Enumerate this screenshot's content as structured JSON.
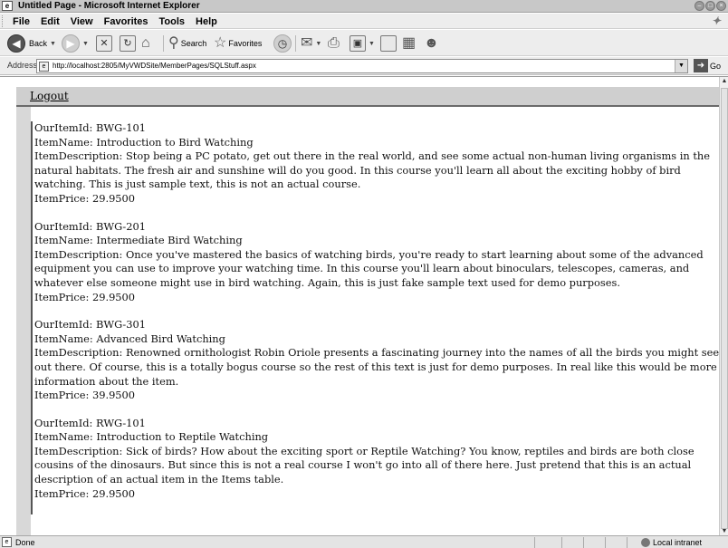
{
  "window": {
    "title": "Untitled Page - Microsoft Internet Explorer"
  },
  "menu": [
    "File",
    "Edit",
    "View",
    "Favorites",
    "Tools",
    "Help"
  ],
  "toolbar": {
    "back_label": "Back",
    "search_label": "Search",
    "favorites_label": "Favorites"
  },
  "address": {
    "label": "Address",
    "url": "http://localhost:2805/MyVWDSite/MemberPages/SQLStuff.aspx",
    "go_label": "Go"
  },
  "page": {
    "logout_link": "Logout",
    "items": [
      {
        "id": "OurItemId: BWG-101",
        "name": "ItemName: Introduction to Bird Watching",
        "description": "ItemDescription: Stop being a PC potato, get out there in the real world, and see some actual non-human living organisms in the natural habitats. The fresh air and sunshine will do you good. In this course you'll learn all about the exciting hobby of bird watching. This is just sample text, this is not an actual course.",
        "price": "ItemPrice: 29.9500"
      },
      {
        "id": "OurItemId: BWG-201",
        "name": "ItemName: Intermediate Bird Watching",
        "description": "ItemDescription: Once you've mastered the basics of watching birds, you're ready to start learning about some of the advanced equipment you can use to improve your watching time. In this course you'll learn about binoculars, telescopes, cameras, and whatever else someone might use in bird watching. Again, this is just fake sample text used for demo purposes.",
        "price": "ItemPrice: 29.9500"
      },
      {
        "id": "OurItemId: BWG-301",
        "name": "ItemName: Advanced Bird Watching",
        "description": "ItemDescription: Renowned ornithologist Robin Oriole presents a fascinating journey into the names of all the birds you might see out there. Of course, this is a totally bogus course so the rest of this text is just for demo purposes. In real like this would be more information about the item.",
        "price": "ItemPrice: 39.9500"
      },
      {
        "id": "OurItemId: RWG-101",
        "name": "ItemName: Introduction to Reptile Watching",
        "description": "ItemDescription: Sick of birds? How about the exciting sport or Reptile Watching? You know, reptiles and birds are both close cousins of the dinosaurs. But since this is not a real course I won't go into all of there here. Just pretend that this is an actual description of an actual item in the Items table.",
        "price": "ItemPrice: 29.9500"
      }
    ]
  },
  "status": {
    "text": "Done",
    "zone": "Local intranet"
  }
}
